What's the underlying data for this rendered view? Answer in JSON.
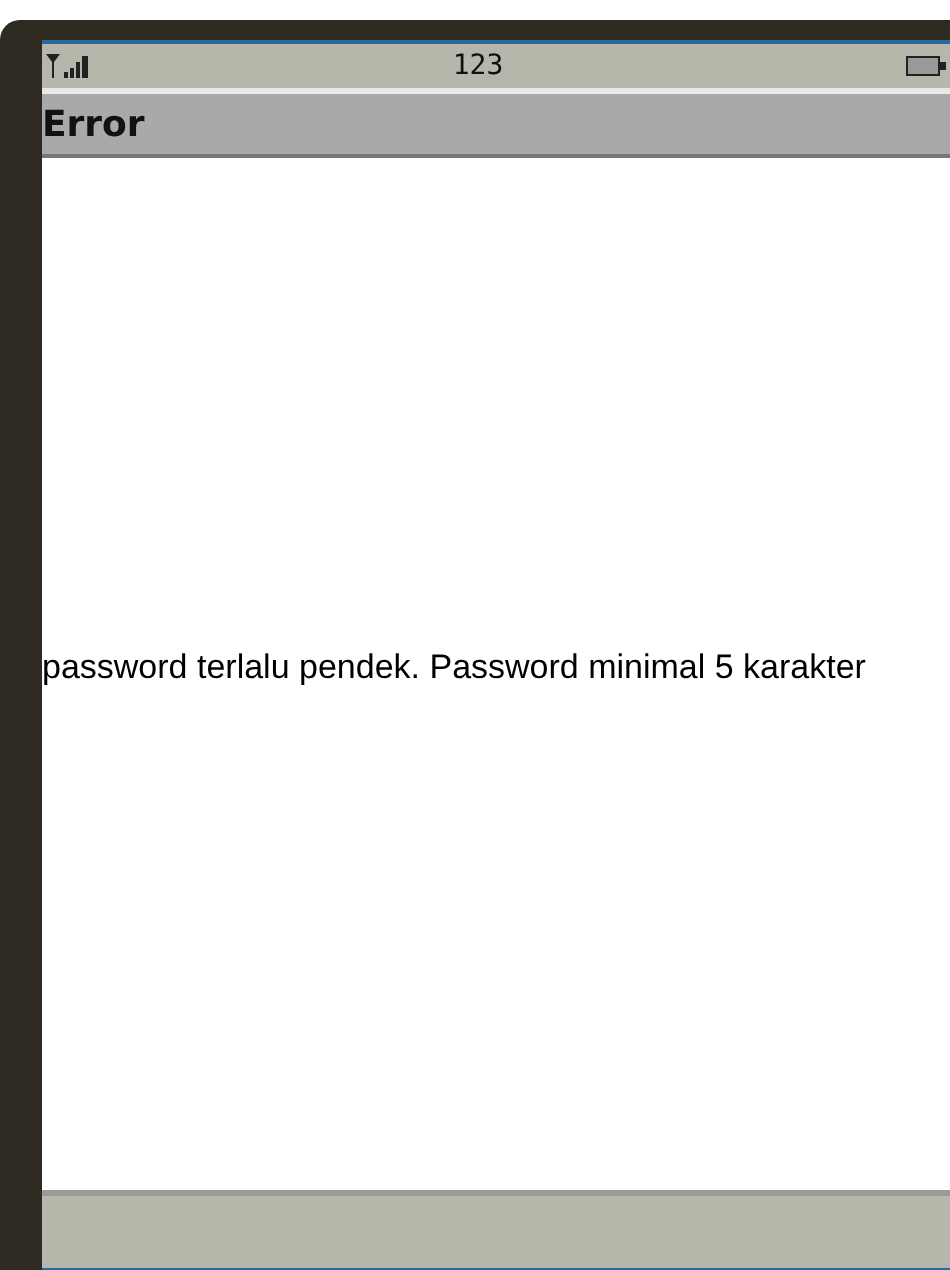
{
  "status_bar": {
    "indicator": "123"
  },
  "title": "Error",
  "message": "password terlalu pendek. Password minimal 5 karakter"
}
